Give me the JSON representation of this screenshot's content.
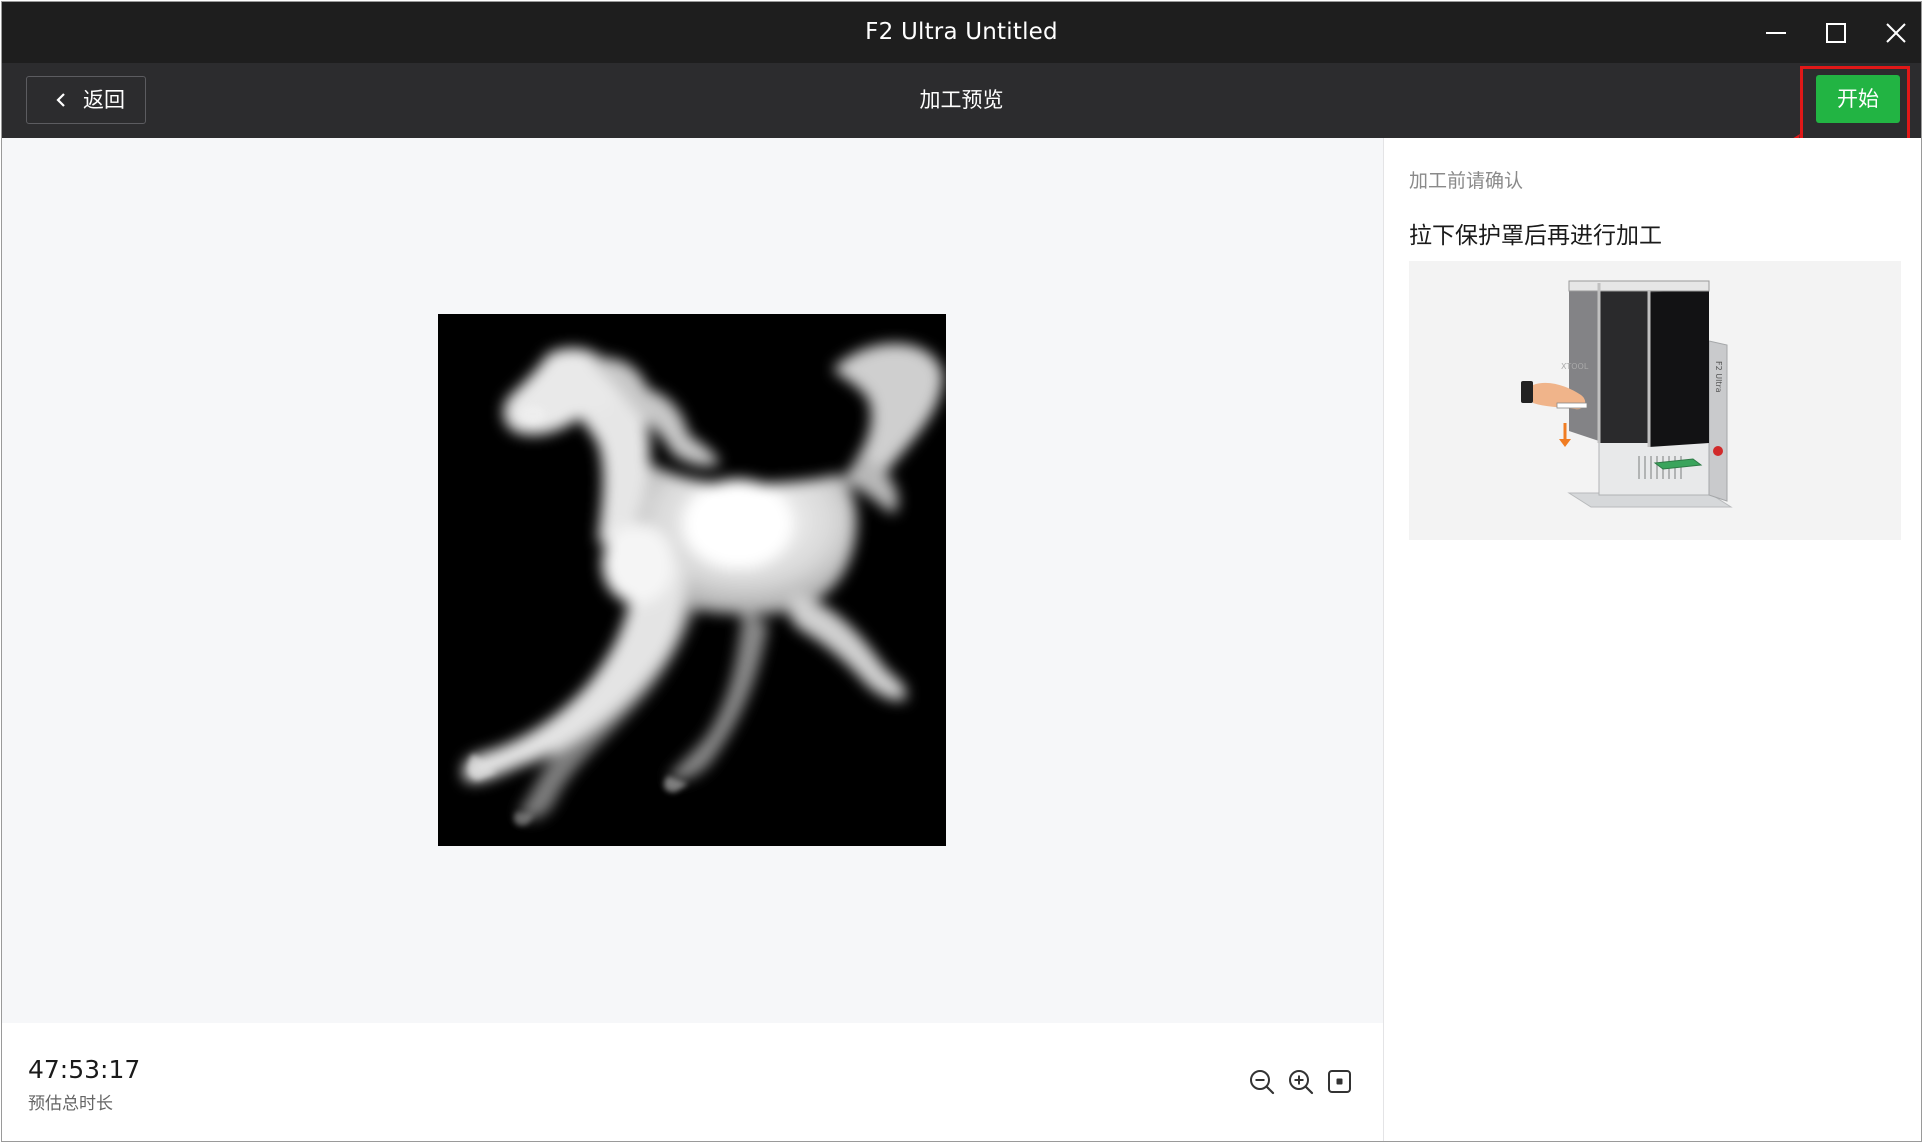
{
  "window": {
    "title": "F2 Ultra Untitled"
  },
  "toolbar": {
    "back_label": "返回",
    "page_title": "加工预览",
    "start_label": "开始"
  },
  "colors": {
    "start_button": "#22b443",
    "annotation": "#e01818",
    "titlebar": "#1e1e1e",
    "toolbar": "#2c2c2e"
  },
  "preview": {
    "estimated_time": "47:53:17",
    "estimated_time_label": "预估总时长"
  },
  "side_panel": {
    "confirm_hint": "加工前请确认",
    "instruction": "拉下保护罩后再进行加工"
  },
  "icons": [
    "minimize-icon",
    "maximize-icon",
    "close-icon",
    "chevron-left-icon",
    "zoom-out-icon",
    "zoom-in-icon",
    "fit-view-icon"
  ]
}
